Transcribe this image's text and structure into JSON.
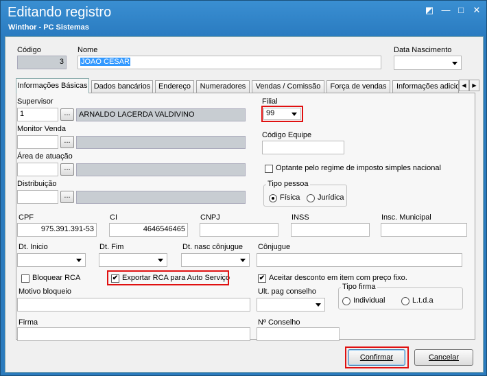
{
  "window": {
    "title": "Editando registro",
    "subtitle": "Winthor - PC Sistemas",
    "restore_glyph": "◩",
    "minimize_glyph": "—",
    "maximize_glyph": "□",
    "close_glyph": "✕"
  },
  "header": {
    "codigo_label": "Código",
    "codigo_value": "3",
    "nome_label": "Nome",
    "nome_value": "JOAO CESAR",
    "data_nascimento_label": "Data Nascimento",
    "data_nascimento_value": ""
  },
  "tabs": [
    {
      "label": "Informações Básicas",
      "active": true
    },
    {
      "label": "Dados bancários"
    },
    {
      "label": "Endereço"
    },
    {
      "label": "Numeradores"
    },
    {
      "label": "Vendas  / Comissão"
    },
    {
      "label": "Força de vendas"
    },
    {
      "label": "Informações adicio"
    }
  ],
  "tab_scroll": {
    "left": "◀",
    "right": "▶"
  },
  "basic": {
    "supervisor_label": "Supervisor",
    "supervisor_code": "1",
    "supervisor_name": "ARNALDO LACERDA VALDIVINO",
    "ellipsis": "...",
    "monitor_venda_label": "Monitor Venda",
    "area_atuacao_label": "Área de atuação",
    "distribuicao_label": "Distribuição",
    "filial_label": "Filial",
    "filial_value": "99",
    "codigo_equipe_label": "Código Equipe",
    "optante_label": "Optante pelo regime de imposto simples nacional",
    "optante_checked": false,
    "tipo_pessoa_label": "Tipo pessoa",
    "fisica_label": "Física",
    "juridica_label": "Jurídica",
    "tipo_pessoa_selected": "Física",
    "cpf_label": "CPF",
    "cpf_value": "975.391.391-53",
    "ci_label": "CI",
    "ci_value": "4646546465",
    "cnpj_label": "CNPJ",
    "inss_label": "INSS",
    "insc_municipal_label": "Insc. Municipal",
    "dt_inicio_label": "Dt. Inicio",
    "dt_fim_label": "Dt. Fim",
    "dt_nasc_conjugue_label": "Dt. nasc cônjugue",
    "conjugue_label": "Cônjugue",
    "bloquear_rca_label": "Bloquear RCA",
    "bloquear_rca_checked": false,
    "exportar_rca_label": "Exportar RCA para Auto Serviço",
    "exportar_rca_checked": true,
    "aceitar_desconto_label": "Aceitar desconto em item com preço fixo.",
    "aceitar_desconto_checked": true,
    "check_mark": "✔",
    "motivo_bloqueio_label": "Motivo bloqueio",
    "ult_pag_conselho_label": "Ult. pag conselho",
    "tipo_firma_label": "Tipo firma",
    "individual_label": "Individual",
    "ltda_label": "L.t.d.a",
    "firma_label": "Firma",
    "no_conselho_label": "Nº Conselho"
  },
  "footer": {
    "confirmar_label": "Confirmar",
    "cancelar_label": "Cancelar"
  },
  "colors": {
    "title_bar": "#2a7bc0",
    "highlight": "#e01010",
    "selection": "#3399ff"
  }
}
